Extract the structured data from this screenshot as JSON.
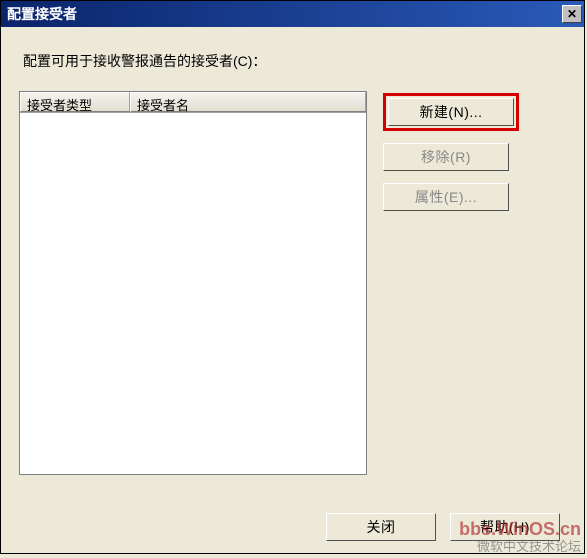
{
  "title": "配置接受者",
  "instruction": "配置可用于接收警报通告的接受者(C)：",
  "columns": {
    "type": "接受者类型",
    "name": "接受者名"
  },
  "buttons": {
    "new": "新建(N)...",
    "remove": "移除(R)",
    "properties": "属性(E)...",
    "close": "关闭",
    "help": "帮助(H)"
  },
  "close_x": "✕",
  "watermark": {
    "line1": "bbs.WinOS.cn",
    "line2": "微软中文技术论坛"
  }
}
